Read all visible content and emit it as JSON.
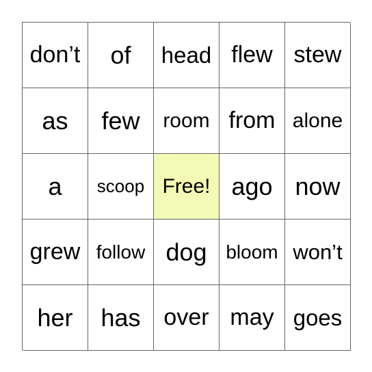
{
  "card": {
    "free_color": "#f3fab5",
    "rows": [
      [
        "don’t",
        "of",
        "head",
        "flew",
        "stew"
      ],
      [
        "as",
        "few",
        "room",
        "from",
        "alone"
      ],
      [
        "a",
        "scoop",
        "Free!",
        "ago",
        "now"
      ],
      [
        "grew",
        "follow",
        "dog",
        "bloom",
        "won’t"
      ],
      [
        "her",
        "has",
        "over",
        "may",
        "goes"
      ]
    ]
  }
}
